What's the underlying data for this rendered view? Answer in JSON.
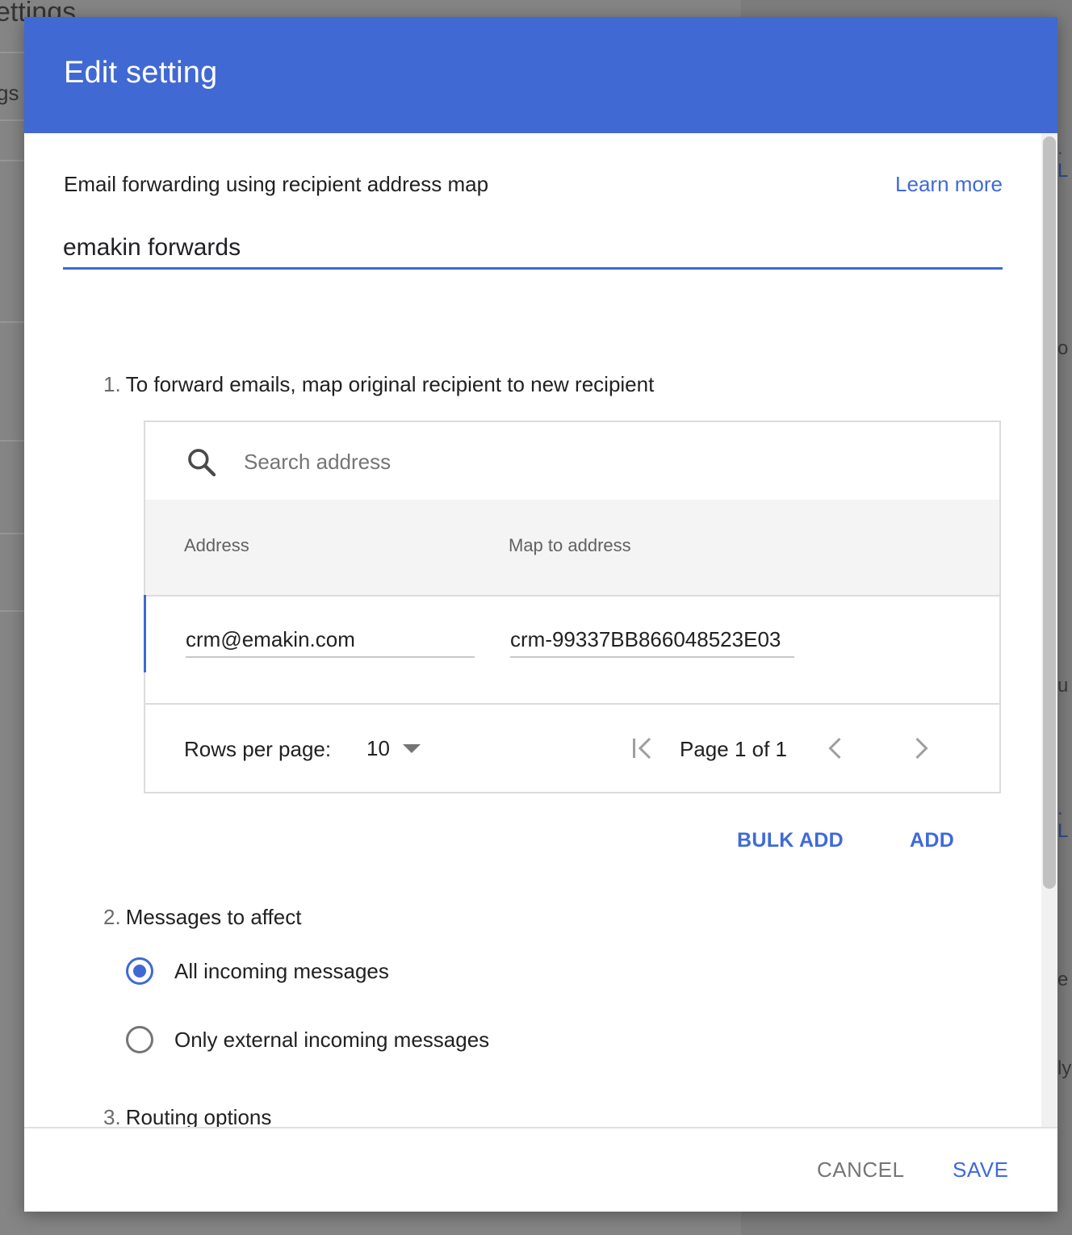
{
  "background": {
    "page_title": "ettings",
    "fragment_gs": "gs",
    "right_fragments": [
      ". L",
      "o",
      "u",
      ". L",
      "e",
      "ly"
    ]
  },
  "dialog": {
    "title": "Edit setting",
    "setting_label": "Email forwarding using recipient address map",
    "learn_more": "Learn more",
    "name_value": "emakin forwards",
    "step1": {
      "num": "1.",
      "text": "To forward emails, map original recipient to new recipient"
    },
    "table": {
      "search_placeholder": "Search address",
      "columns": [
        "Address",
        "Map to address"
      ],
      "rows": [
        {
          "address": "crm@emakin.com",
          "map_to": "crm-99337BB866048523E03"
        }
      ],
      "rows_per_page_label": "Rows per page:",
      "rows_per_page_value": "10",
      "page_text": "Page 1 of 1"
    },
    "bulk_add": "BULK ADD",
    "add": "ADD",
    "step2": {
      "num": "2.",
      "text": "Messages to affect"
    },
    "radio_options": [
      {
        "label": "All incoming messages",
        "checked": true
      },
      {
        "label": "Only external incoming messages",
        "checked": false
      }
    ],
    "step3": {
      "num": "3.",
      "text": "Routing options"
    },
    "cancel": "CANCEL",
    "save": "SAVE"
  },
  "colors": {
    "header": "#4169d3",
    "accent": "#3f6ad8",
    "text": "#212121",
    "muted": "#757575"
  }
}
